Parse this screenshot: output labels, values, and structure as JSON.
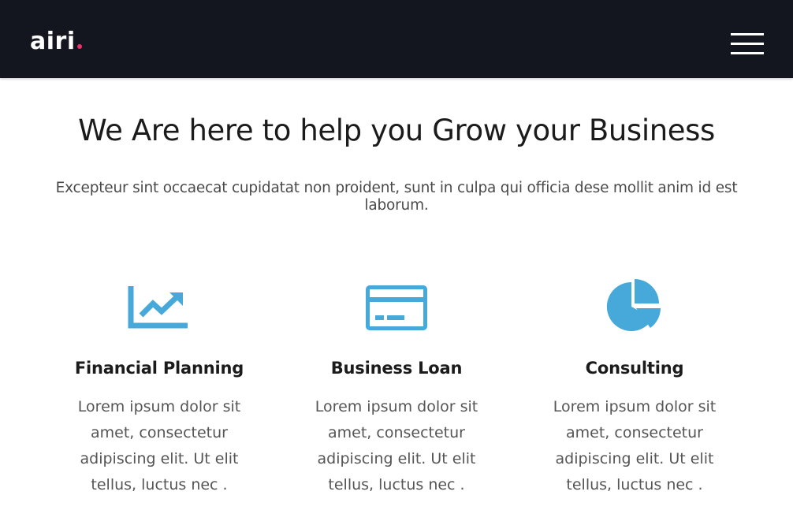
{
  "navbar": {
    "logo_text": "airi",
    "logo_dot_color": "#e8336d",
    "menu_icon": "hamburger-menu-icon",
    "background": "#13161f"
  },
  "hero": {
    "title": "We Are here to help you Grow your Business",
    "subtitle": "Excepteur sint occaecat cupidatat non proident, sunt in culpa qui officia dese mollit anim id est laborum."
  },
  "accent_color": "#46a9d9",
  "features": [
    {
      "icon": "trending-chart-icon",
      "title": "Financial Planning",
      "text": "Lorem ipsum dolor sit amet, consectetur adipiscing elit. Ut elit tellus, luctus nec ."
    },
    {
      "icon": "credit-card-icon",
      "title": "Business Loan",
      "text": "Lorem ipsum dolor sit amet, consectetur adipiscing elit. Ut elit tellus, luctus nec ."
    },
    {
      "icon": "pie-chart-icon",
      "title": "Consulting",
      "text": "Lorem ipsum dolor sit amet, consectetur adipiscing elit. Ut elit tellus, luctus nec ."
    }
  ]
}
